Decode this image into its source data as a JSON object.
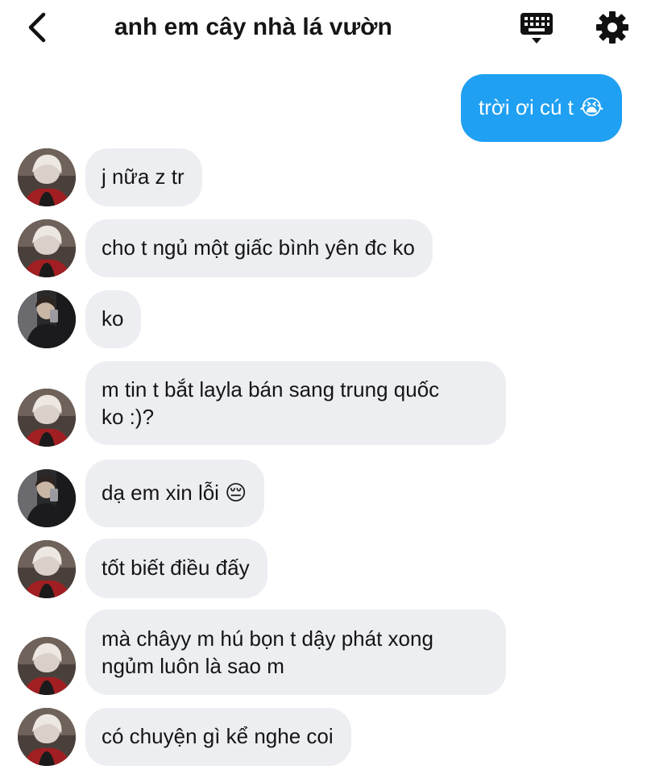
{
  "header": {
    "title": "anh em cây nhà lá vườn",
    "back_icon": "chevron-left-icon",
    "keyboard_icon": "keyboard-icon",
    "settings_icon": "gear-icon"
  },
  "messages": [
    {
      "direction": "out",
      "text": "trời ơi cú t 😭"
    },
    {
      "direction": "in",
      "avatar": "avatar-a",
      "text": "j nữa z tr"
    },
    {
      "direction": "in",
      "avatar": "avatar-a",
      "text": "cho t ngủ một giấc bình yên đc ko"
    },
    {
      "direction": "in",
      "avatar": "avatar-b",
      "text": "ko"
    },
    {
      "direction": "in",
      "avatar": "avatar-a",
      "line1": "m tin t bắt layla bán sang trung quốc",
      "line2": "ko :)?"
    },
    {
      "direction": "in",
      "avatar": "avatar-b",
      "text": "dạ em xin lỗi 😔"
    },
    {
      "direction": "in",
      "avatar": "avatar-a",
      "text": "tốt biết điều đấy"
    },
    {
      "direction": "in",
      "avatar": "avatar-a",
      "line1": "mà châyy m hú bọn t dậy phát xong",
      "line2": "ngủm luôn là sao m"
    },
    {
      "direction": "in",
      "avatar": "avatar-a",
      "text": "có chuyện gì kể nghe coi"
    }
  ],
  "colors": {
    "incoming_bubble": "#edeef1",
    "outgoing_bubble": "#1fa0f2",
    "text": "#151515"
  }
}
